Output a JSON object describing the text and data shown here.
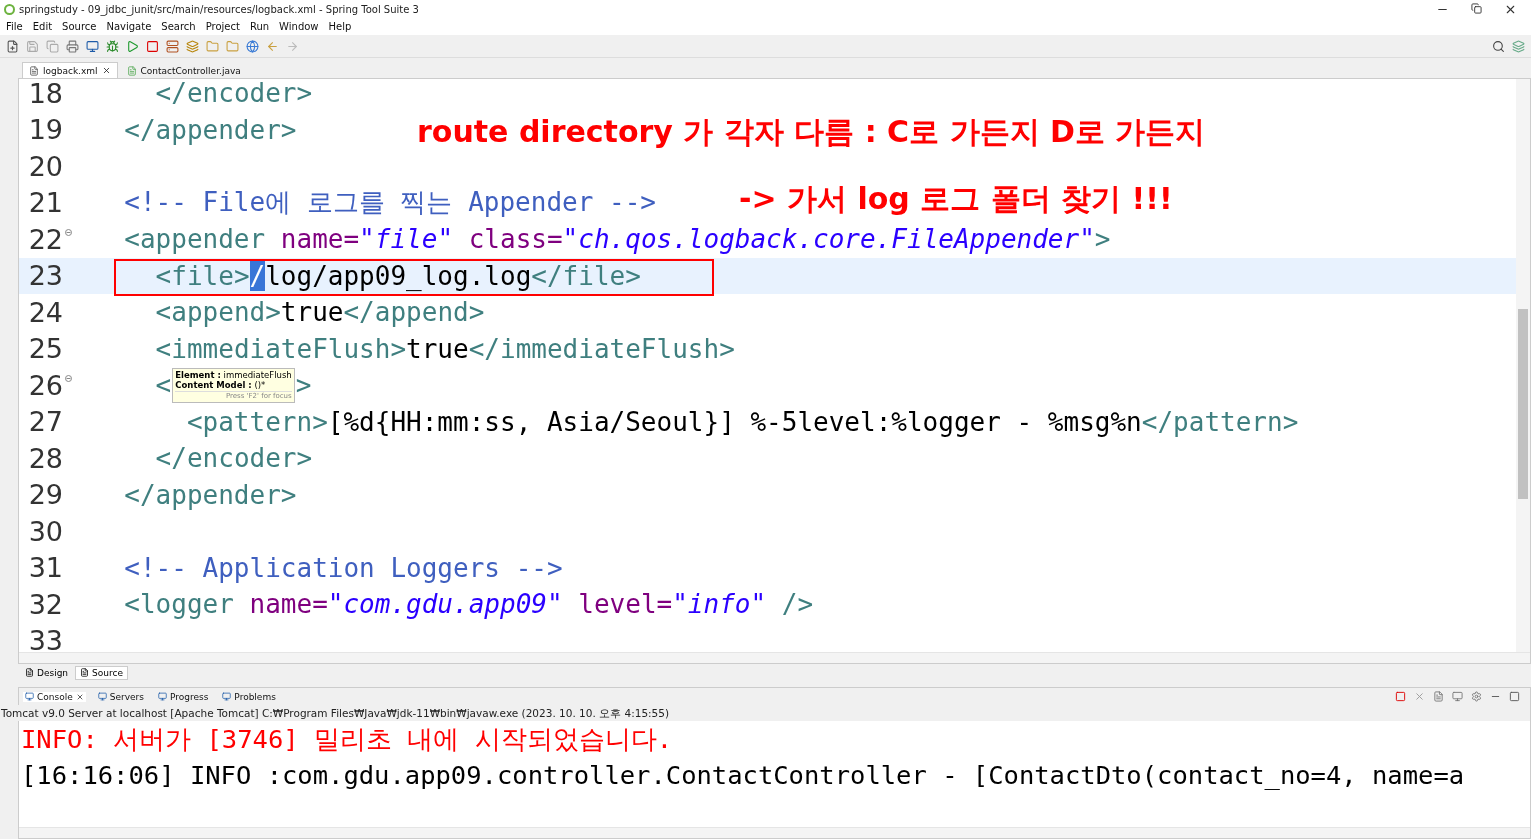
{
  "window": {
    "title": "springstudy - 09_jdbc_junit/src/main/resources/logback.xml - Spring Tool Suite 3"
  },
  "menu": [
    "File",
    "Edit",
    "Source",
    "Navigate",
    "Search",
    "Project",
    "Run",
    "Window",
    "Help"
  ],
  "editor_tabs": [
    {
      "label": "logback.xml",
      "selected": true,
      "kind": "xml"
    },
    {
      "label": "ContactController.java",
      "selected": false,
      "kind": "java"
    }
  ],
  "editor": {
    "lines": [
      {
        "number": "18",
        "current": false,
        "foldable": false,
        "tokens": [
          {
            "kind": "tag",
            "text": "    </encoder>"
          }
        ]
      },
      {
        "number": "19",
        "current": false,
        "foldable": false,
        "tokens": [
          {
            "kind": "tag",
            "text": "  </appender>"
          }
        ]
      },
      {
        "number": "20",
        "current": false,
        "foldable": false
      },
      {
        "number": "21",
        "current": false,
        "foldable": false,
        "tokens": [
          {
            "kind": "comment",
            "text": "  <!-- File에 로그를 찍는 Appender -->"
          }
        ]
      },
      {
        "number": "22",
        "current": false,
        "foldable": true,
        "tokens": [
          {
            "kind": "tag",
            "text": "  <appender"
          },
          {
            "kind": "attr",
            "text": " name="
          },
          {
            "kind": "value",
            "text": "\"file\""
          },
          {
            "kind": "attr",
            "text": " class="
          },
          {
            "kind": "value",
            "text": "\"ch.qos.logback.core.FileAppender\""
          },
          {
            "kind": "tag",
            "text": ">"
          }
        ]
      },
      {
        "number": "23",
        "current": true,
        "foldable": false,
        "tokens": [
          {
            "kind": "tag",
            "text": "    <file>"
          },
          {
            "kind": "selection",
            "text": "/"
          },
          {
            "kind": "text",
            "text": "log/app09_log.log"
          },
          {
            "kind": "tag",
            "text": "</file>"
          }
        ]
      },
      {
        "number": "24",
        "current": false,
        "foldable": false,
        "tokens": [
          {
            "kind": "tag",
            "text": "    <append>"
          },
          {
            "kind": "text",
            "text": "true"
          },
          {
            "kind": "tag",
            "text": "</append>"
          }
        ]
      },
      {
        "number": "25",
        "current": false,
        "foldable": false,
        "tokens": [
          {
            "kind": "tag",
            "text": "    <immediateFlush>"
          },
          {
            "kind": "text",
            "text": "true"
          },
          {
            "kind": "tag",
            "text": "</immediateFlush>"
          }
        ]
      },
      {
        "number": "26",
        "current": false,
        "foldable": true,
        "tokens": [
          {
            "kind": "tag",
            "text": "    <"
          },
          {
            "kind": "tooltip"
          },
          {
            "kind": "tag",
            "text": ">"
          }
        ]
      },
      {
        "number": "27",
        "current": false,
        "foldable": false,
        "tokens": [
          {
            "kind": "tag",
            "text": "      <pattern>"
          },
          {
            "kind": "text",
            "text": "[%d{HH:mm:ss, Asia/Seoul}] %-5level:%logger - %msg%n"
          },
          {
            "kind": "tag",
            "text": "</pattern>"
          }
        ]
      },
      {
        "number": "28",
        "current": false,
        "foldable": false,
        "tokens": [
          {
            "kind": "tag",
            "text": "    </encoder>"
          }
        ]
      },
      {
        "number": "29",
        "current": false,
        "foldable": false,
        "tokens": [
          {
            "kind": "tag",
            "text": "  </appender>"
          }
        ]
      },
      {
        "number": "30",
        "current": false,
        "foldable": false
      },
      {
        "number": "31",
        "current": false,
        "foldable": false,
        "tokens": [
          {
            "kind": "comment",
            "text": "  <!-- Application Loggers -->"
          }
        ]
      },
      {
        "number": "32",
        "current": false,
        "foldable": false,
        "tokens": [
          {
            "kind": "tag",
            "text": "  <logger"
          },
          {
            "kind": "attr",
            "text": " name="
          },
          {
            "kind": "value",
            "text": "\"com.gdu.app09\""
          },
          {
            "kind": "attr",
            "text": " level="
          },
          {
            "kind": "value",
            "text": "\"info\""
          },
          {
            "kind": "tag",
            "text": " />"
          }
        ]
      },
      {
        "number": "33",
        "current": false,
        "foldable": false
      }
    ],
    "tooltip": {
      "element_label": "Element :",
      "element": "immediateFlush",
      "model_label": "Content Model :",
      "model": "()*",
      "hint": "Press 'F2' for focus"
    },
    "annotations": [
      {
        "kind": "note",
        "text": "route directory 가 각자 다름 : C로 가든지 D로 가든지"
      },
      {
        "kind": "note",
        "text": "-> 가서 log 로그 폴더 찾기 !!!"
      },
      {
        "kind": "frame"
      }
    ]
  },
  "view_tabs": [
    {
      "label": "Design",
      "selected": false
    },
    {
      "label": "Source",
      "selected": true
    }
  ],
  "console_tabs": [
    {
      "label": "Console",
      "selected": true
    },
    {
      "label": "Servers",
      "selected": false
    },
    {
      "label": "Progress",
      "selected": false
    },
    {
      "label": "Problems",
      "selected": false
    }
  ],
  "console": {
    "header": "Tomcat v9.0 Server at localhost [Apache Tomcat] C:₩Program Files₩Java₩jdk-11₩bin₩javaw.exe  (2023. 10. 10. 오후 4:15:55)",
    "lines": [
      {
        "kind": "error",
        "text": "INFO: 서버가 [3746] 밀리초 내에 시작되었습니다."
      },
      {
        "kind": "output",
        "text": "[16:16:06] INFO :com.gdu.app09.controller.ContactController - [ContactDto(contact_no=4, name=a"
      }
    ]
  }
}
